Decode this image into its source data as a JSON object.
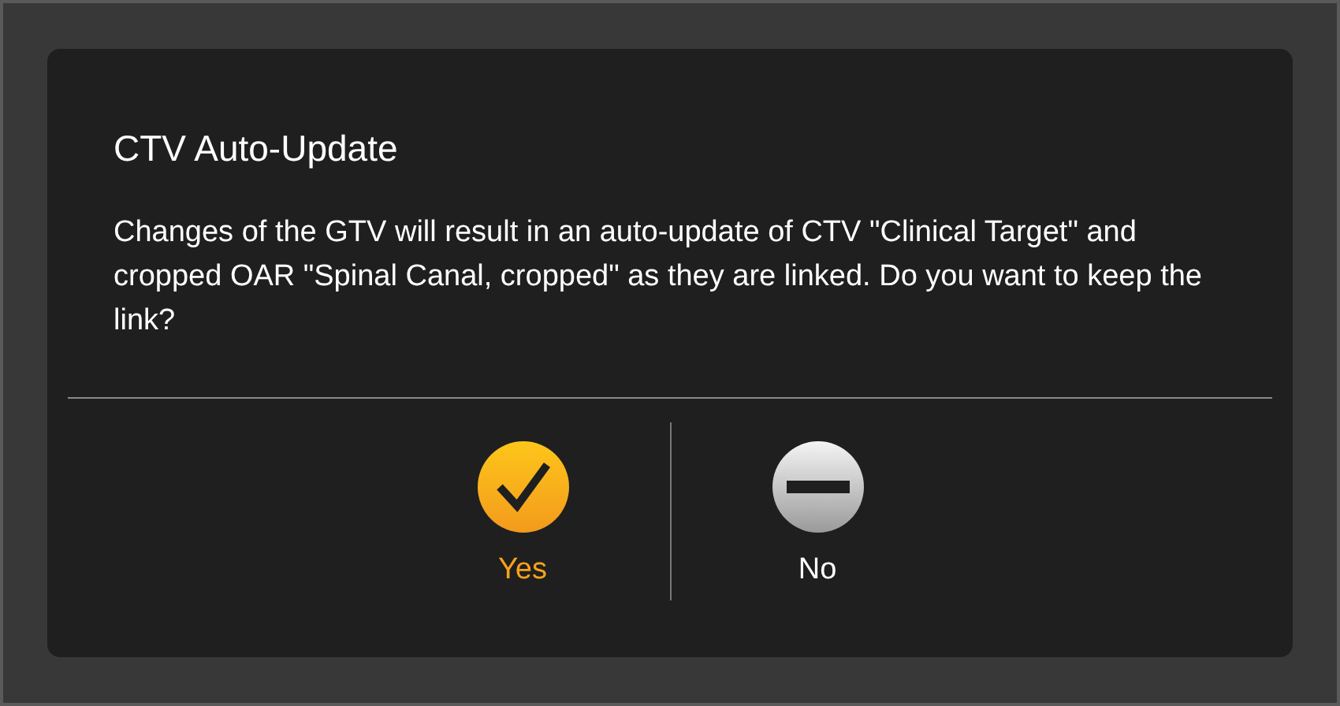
{
  "dialog": {
    "title": "CTV Auto-Update",
    "message": "Changes of the GTV will result in an auto-update of CTV \"Clinical Target\" and cropped OAR \"Spinal Canal, cropped\" as they are linked. Do you want to keep the link?",
    "buttons": [
      {
        "label": "Yes",
        "kind": "confirm"
      },
      {
        "label": "No",
        "kind": "cancel"
      }
    ]
  }
}
